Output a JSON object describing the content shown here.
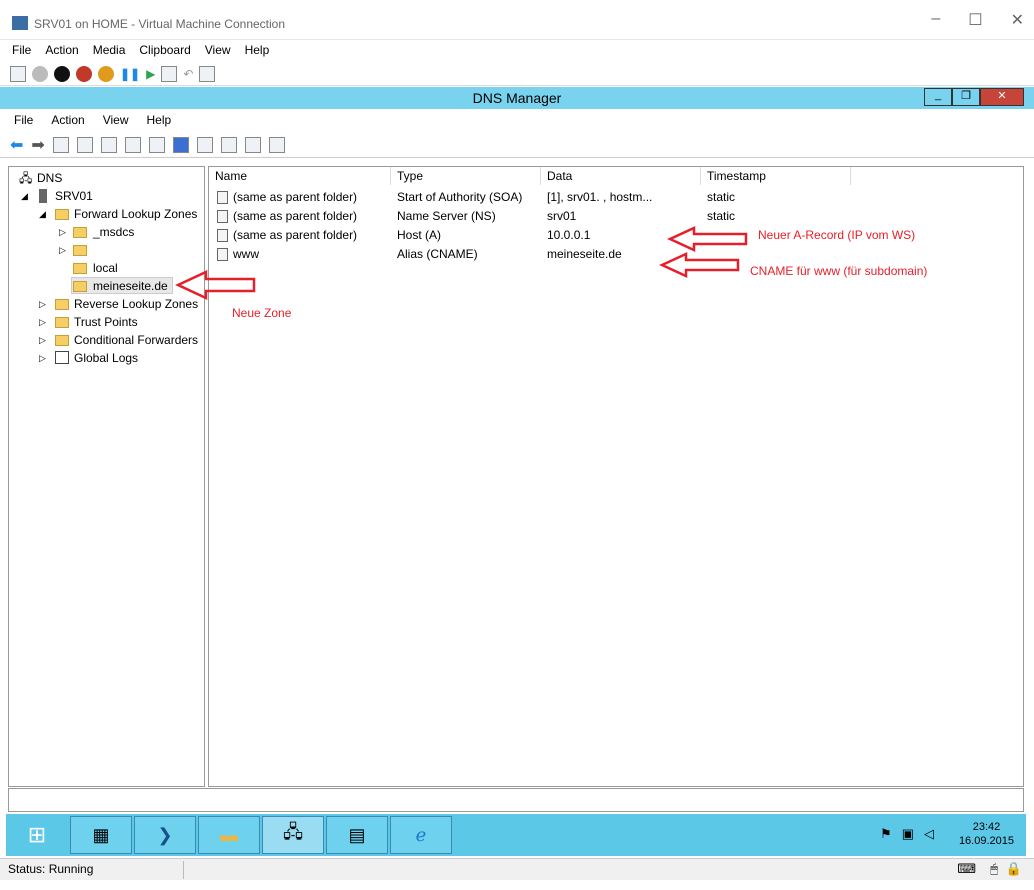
{
  "vm": {
    "title": "SRV01 on HOME - Virtual Machine Connection",
    "min": "–",
    "max": "☐",
    "close": "✕",
    "menu": [
      "File",
      "Action",
      "Media",
      "Clipboard",
      "View",
      "Help"
    ]
  },
  "dns": {
    "title": "DNS Manager",
    "menu": [
      "File",
      "Action",
      "View",
      "Help"
    ],
    "tree": {
      "root": "DNS",
      "server": "SRV01",
      "forward": "Forward Lookup Zones",
      "msdcs": "_msdcs",
      "blank": "",
      "local": "local",
      "zone": "meineseite.de",
      "reverse": "Reverse Lookup Zones",
      "trust": "Trust Points",
      "conditional": "Conditional Forwarders",
      "logs": "Global Logs"
    },
    "columns": [
      "Name",
      "Type",
      "Data",
      "Timestamp"
    ],
    "rows": [
      {
        "name": "(same as parent folder)",
        "type": "Start of Authority (SOA)",
        "data": "[1], srv01.           , hostm...",
        "timestamp": "static"
      },
      {
        "name": "(same as parent folder)",
        "type": "Name Server (NS)",
        "data": "srv01",
        "timestamp": "static"
      },
      {
        "name": "(same as parent folder)",
        "type": "Host (A)",
        "data": "10.0.0.1",
        "timestamp": ""
      },
      {
        "name": "www",
        "type": "Alias (CNAME)",
        "data": "meineseite.de",
        "timestamp": ""
      }
    ]
  },
  "annotations": {
    "arecord": "Neuer A-Record (IP vom WS)",
    "cname": "CNAME für www (für subdomain)",
    "zone": "Neue Zone",
    "color": "#e5202a"
  },
  "taskbar": {
    "time": "23:42",
    "date": "16.09.2015"
  },
  "status": "Status: Running"
}
